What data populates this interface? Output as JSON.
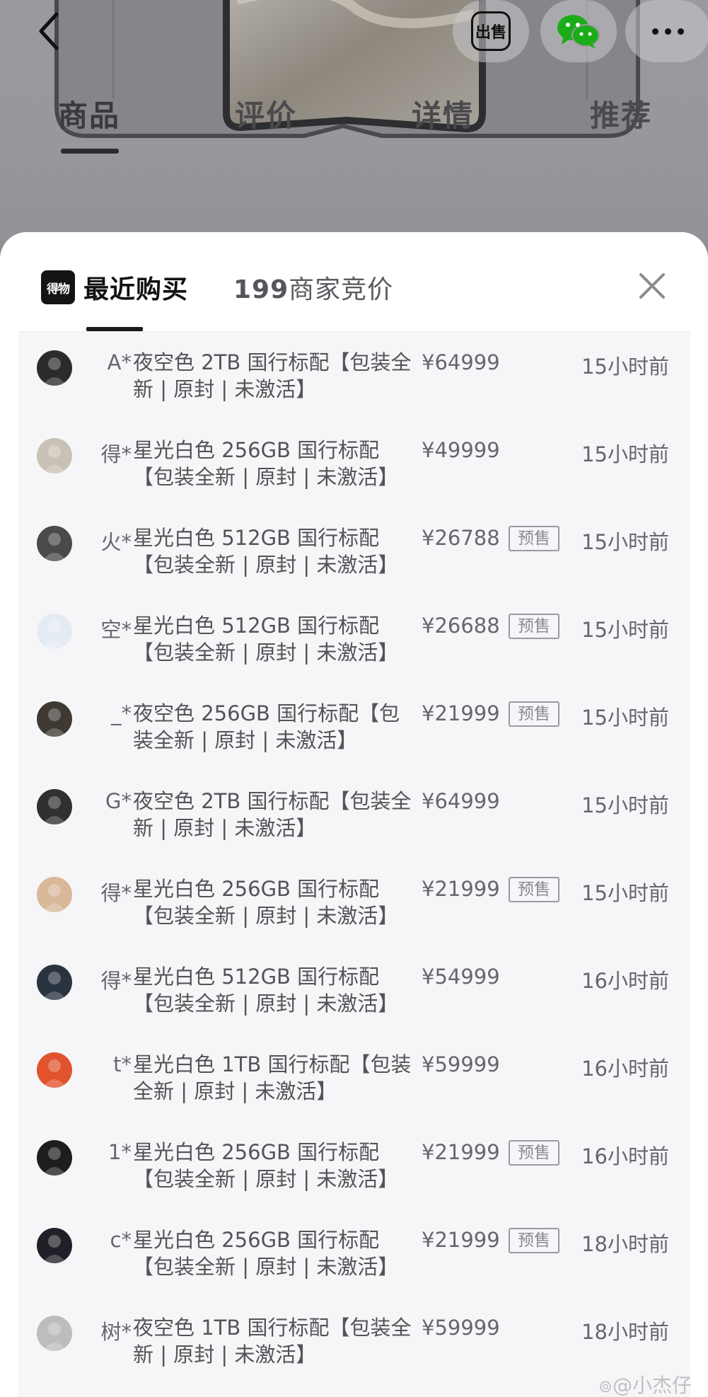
{
  "background_page": {
    "tabs": [
      "商品",
      "评价",
      "详情",
      "推荐"
    ],
    "icons": {
      "back": "back-arrow-icon",
      "sell": "出售",
      "share": "wechat-icon",
      "more": "more-icon"
    }
  },
  "sheet": {
    "brand_logo_text": "得物",
    "tab_active": "最近购买",
    "tab_inactive_count": "199",
    "tab_inactive_text": "商家竞价",
    "close_icon": "close-icon"
  },
  "records": [
    {
      "user": "A*",
      "desc": "夜空色 2TB 国行标配【包装全新 | 原封 | 未激活】",
      "price": "¥64999",
      "presale": "",
      "time": "15小时前",
      "avatar_color": "#2b2b2b"
    },
    {
      "user": "得*",
      "desc": "星光白色 256GB 国行标配【包装全新 | 原封 | 未激活】",
      "price": "¥49999",
      "presale": "",
      "time": "15小时前",
      "avatar_color": "#c9c2b4"
    },
    {
      "user": "火*",
      "desc": "星光白色 512GB 国行标配【包装全新 | 原封 | 未激活】",
      "price": "¥26788",
      "presale": "预售",
      "time": "15小时前",
      "avatar_color": "#4a4a4a"
    },
    {
      "user": "空*",
      "desc": "星光白色 512GB 国行标配【包装全新 | 原封 | 未激活】",
      "price": "¥26688",
      "presale": "预售",
      "time": "15小时前",
      "avatar_color": "#e4ebf2"
    },
    {
      "user": "_*",
      "desc": "夜空色 256GB 国行标配【包装全新 | 原封 | 未激活】",
      "price": "¥21999",
      "presale": "预售",
      "time": "15小时前",
      "avatar_color": "#3e3a33"
    },
    {
      "user": "G*",
      "desc": "夜空色 2TB 国行标配【包装全新 | 原封 | 未激活】",
      "price": "¥64999",
      "presale": "",
      "time": "15小时前",
      "avatar_color": "#303030"
    },
    {
      "user": "得*",
      "desc": "星光白色 256GB 国行标配【包装全新 | 原封 | 未激活】",
      "price": "¥21999",
      "presale": "预售",
      "time": "15小时前",
      "avatar_color": "#d9b89a"
    },
    {
      "user": "得*",
      "desc": "星光白色 512GB 国行标配【包装全新 | 原封 | 未激活】",
      "price": "¥54999",
      "presale": "",
      "time": "16小时前",
      "avatar_color": "#2a3440"
    },
    {
      "user": "t*",
      "desc": "星光白色 1TB 国行标配【包装全新 | 原封 | 未激活】",
      "price": "¥59999",
      "presale": "",
      "time": "16小时前",
      "avatar_color": "#e0532c"
    },
    {
      "user": "1*",
      "desc": "星光白色 256GB 国行标配【包装全新 | 原封 | 未激活】",
      "price": "¥21999",
      "presale": "预售",
      "time": "16小时前",
      "avatar_color": "#1e1e1e"
    },
    {
      "user": "c*",
      "desc": "星光白色 256GB 国行标配【包装全新 | 原封 | 未激活】",
      "price": "¥21999",
      "presale": "预售",
      "time": "18小时前",
      "avatar_color": "#202028"
    },
    {
      "user": "树*",
      "desc": "夜空色 1TB 国行标配【包装全新 | 原封 | 未激活】",
      "price": "¥59999",
      "presale": "",
      "time": "18小时前",
      "avatar_color": "#bdbdbd"
    }
  ],
  "watermark": "@小杰仔"
}
